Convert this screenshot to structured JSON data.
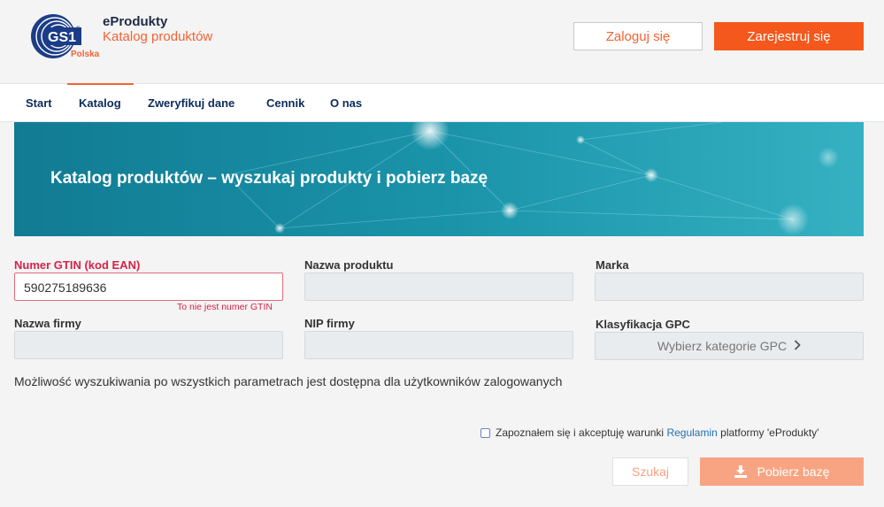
{
  "header": {
    "logo": {
      "main": "GS1",
      "sub": "Polska"
    },
    "brand_title": "eProdukty",
    "brand_subtitle": "Katalog produktów",
    "login_label": "Zaloguj się",
    "register_label": "Zarejestruj się"
  },
  "nav": {
    "items": [
      {
        "label": "Start"
      },
      {
        "label": "Katalog"
      },
      {
        "label": "Zweryfikuj dane"
      },
      {
        "label": "Cennik"
      },
      {
        "label": "O nas"
      }
    ],
    "active": "Katalog"
  },
  "banner": {
    "title": "Katalog produktów – wyszukaj produkty i pobierz bazę"
  },
  "form": {
    "gtin": {
      "label": "Numer GTIN (kod EAN)",
      "value": "590275189636",
      "error": "To nie jest numer GTIN"
    },
    "product_name": {
      "label": "Nazwa produktu",
      "value": ""
    },
    "brand": {
      "label": "Marka",
      "value": ""
    },
    "company_name": {
      "label": "Nazwa firmy",
      "value": ""
    },
    "nip": {
      "label": "NIP firmy",
      "value": ""
    },
    "gpc": {
      "label": "Klasyfikacja GPC",
      "button_label": "Wybierz kategorie GPC"
    },
    "note": "Możliwość wyszukiwania po wszystkich parametrach jest dostępna dla użytkowników zalogowanych",
    "terms": {
      "checked": false,
      "text_before": "Zapoznałem się i akceptuję warunki",
      "link_text": "Regulamin",
      "text_after": "platformy 'eProdukty'"
    },
    "search_label": "Szukaj",
    "download_label": "Pobierz bazę"
  },
  "colors": {
    "accent": "#f4581c",
    "navy": "#0b2b5a",
    "error": "#d6224a",
    "link": "#1f73b7",
    "banner": "#1b8fa5"
  },
  "icons": {
    "download": "download-icon",
    "chevron": "chevron-right-icon"
  }
}
